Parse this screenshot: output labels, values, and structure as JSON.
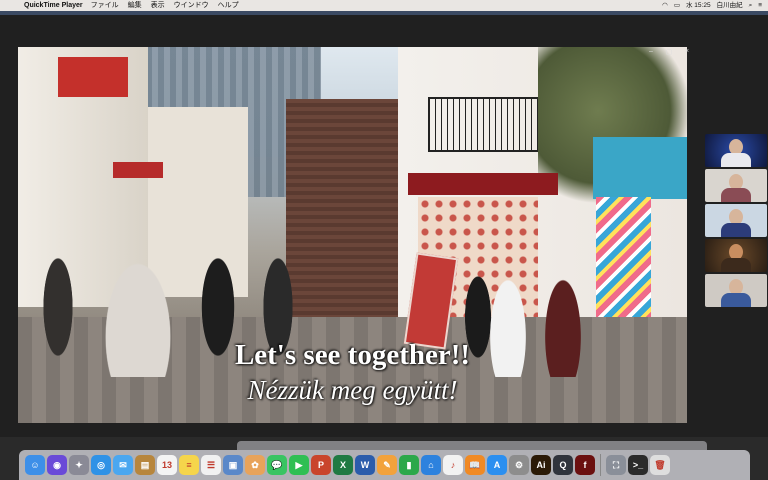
{
  "menubar": {
    "app_name": "QuickTime Player",
    "menus": [
      "ファイル",
      "編集",
      "表示",
      "ウインドウ",
      "ヘルプ"
    ],
    "time": "水 15:25",
    "user": "白川由紀"
  },
  "video": {
    "caption_en": "Let's see together!!",
    "caption_hu": "Nézzük meg együtt!"
  },
  "window_controls": [
    "–",
    "▢",
    "×"
  ],
  "dock": {
    "items": [
      {
        "icon": "finder-icon",
        "color": "#3d8fe8",
        "glyph": "☺"
      },
      {
        "icon": "siri-icon",
        "color": "#6a4ad8",
        "glyph": "◉"
      },
      {
        "icon": "launchpad-icon",
        "color": "#8a8a96",
        "glyph": "✦"
      },
      {
        "icon": "safari-icon",
        "color": "#2f92e6",
        "glyph": "◎"
      },
      {
        "icon": "mail-icon",
        "color": "#4aa7f0",
        "glyph": "✉"
      },
      {
        "icon": "notes-folder-icon",
        "color": "#b7863d",
        "glyph": "▤"
      },
      {
        "icon": "calendar-icon",
        "color": "#f4f4f4",
        "glyph": "13"
      },
      {
        "icon": "notes-icon",
        "color": "#f5d54b",
        "glyph": "≡"
      },
      {
        "icon": "reminders-icon",
        "color": "#f1f1f1",
        "glyph": "☰"
      },
      {
        "icon": "preview-icon",
        "color": "#5a88c9",
        "glyph": "▣"
      },
      {
        "icon": "photos-icon",
        "color": "#e8a35a",
        "glyph": "✿"
      },
      {
        "icon": "messages-icon",
        "color": "#39c462",
        "glyph": "💬"
      },
      {
        "icon": "facetime-icon",
        "color": "#2fbf53",
        "glyph": "▶"
      },
      {
        "icon": "powerpoint-icon",
        "color": "#c9452c",
        "glyph": "P"
      },
      {
        "icon": "excel-icon",
        "color": "#1f7a43",
        "glyph": "X"
      },
      {
        "icon": "word-icon",
        "color": "#2b5cab",
        "glyph": "W"
      },
      {
        "icon": "pages-icon",
        "color": "#f2a23c",
        "glyph": "✎"
      },
      {
        "icon": "numbers-icon",
        "color": "#2ca84a",
        "glyph": "▮"
      },
      {
        "icon": "keynote-icon",
        "color": "#2d82de",
        "glyph": "⌂"
      },
      {
        "icon": "music-icon",
        "color": "#f2f2f2",
        "glyph": "♪"
      },
      {
        "icon": "books-icon",
        "color": "#f08a24",
        "glyph": "📖"
      },
      {
        "icon": "app-store-icon",
        "color": "#2b8ff0",
        "glyph": "A"
      },
      {
        "icon": "system-preferences-icon",
        "color": "#8d8d8d",
        "glyph": "⚙"
      },
      {
        "icon": "illustrator-icon",
        "color": "#2b1a06",
        "glyph": "Ai"
      },
      {
        "icon": "quicktime-icon",
        "color": "#30343c",
        "glyph": "Q"
      },
      {
        "icon": "flash-icon",
        "color": "#6b1010",
        "glyph": "f"
      },
      {
        "icon": "screenshot-icon",
        "color": "#8a8f99",
        "glyph": "⛶"
      },
      {
        "icon": "terminal-icon",
        "color": "#2b2b2b",
        "glyph": ">_"
      },
      {
        "icon": "trash-icon",
        "color": "#dedede",
        "glyph": "🗑"
      }
    ]
  }
}
